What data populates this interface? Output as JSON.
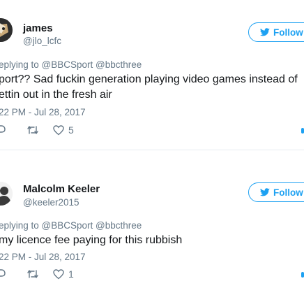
{
  "tweets": [
    {
      "name": "james",
      "handle": "@jlo_lcfc",
      "follow_label": "Follow",
      "reply_prefix": "eplying to @BBCSport @bbcthree",
      "text_lines": [
        "port?? Sad fuckin generation playing video games instead of",
        "ettin out in the fresh air"
      ],
      "timestamp": "22 PM - Jul 28, 2017",
      "like_count": "5"
    },
    {
      "name": "Malcolm Keeler",
      "handle": "@keeler2015",
      "follow_label": "Follow",
      "reply_prefix": "eplying to @BBCSport @bbcthree",
      "text_lines": [
        "my licence fee paying for this rubbish"
      ],
      "timestamp": "22 PM - Jul 28, 2017",
      "like_count": "1"
    }
  ],
  "colors": {
    "accent": "#1da1f2",
    "secondary_text": "#657786",
    "primary_text": "#14171a",
    "divider": "#e6ecf0"
  },
  "icons": {
    "follow": "twitter-bird-icon",
    "reply": "reply-icon",
    "retweet": "retweet-icon",
    "like": "heart-icon"
  }
}
